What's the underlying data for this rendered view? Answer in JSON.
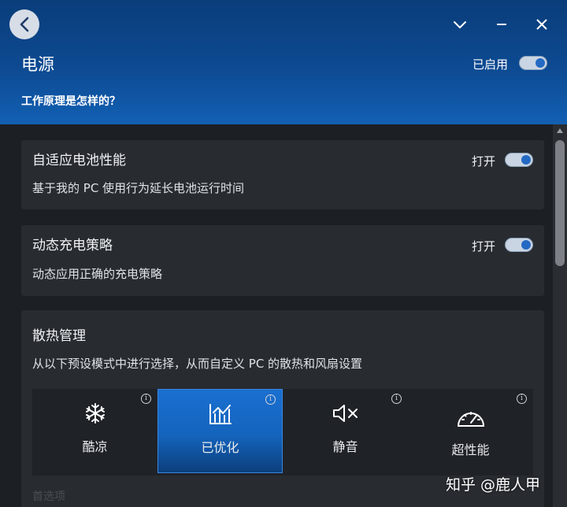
{
  "header": {
    "title": "电源",
    "enabled_label": "已启用",
    "how_it_works": "工作原理是怎样的？",
    "enabled_state": true
  },
  "cards": [
    {
      "title": "自适应电池性能",
      "description": "基于我的 PC 使用行为延长电池运行时间",
      "toggle_label": "打开",
      "toggle_state": true
    },
    {
      "title": "动态充电策略",
      "description": "动态应用正确的充电策略",
      "toggle_label": "打开",
      "toggle_state": true
    }
  ],
  "thermal": {
    "title": "散热管理",
    "description": "从以下预设模式中进行选择，从而自定义 PC 的散热和风扇设置",
    "modes": [
      {
        "label": "酷凉",
        "icon": "snowflake-icon",
        "selected": false
      },
      {
        "label": "已优化",
        "icon": "optimized-chart-icon",
        "selected": true
      },
      {
        "label": "静音",
        "icon": "mute-speaker-icon",
        "selected": false
      },
      {
        "label": "超性能",
        "icon": "speedometer-icon",
        "selected": false
      }
    ],
    "info_glyph": "i"
  },
  "next_section_label": "首选项",
  "watermark": "知乎 @鹿人甲",
  "colors": {
    "header_top": "#0a3d7a",
    "header_bottom": "#1260b4",
    "accent": "#2469c4",
    "card_bg": "#282c31",
    "selected_mode": "#1a6fd0"
  }
}
